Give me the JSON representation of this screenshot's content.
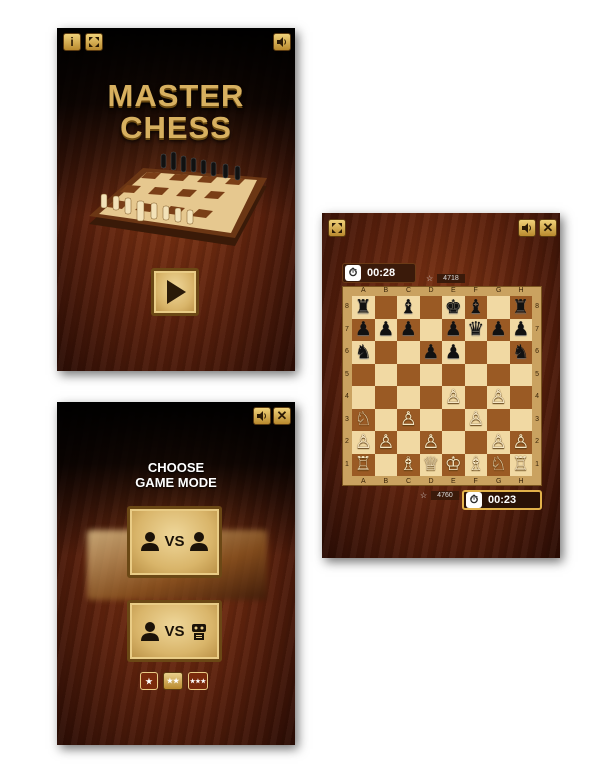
{
  "splash": {
    "title_line1": "MASTER",
    "title_line2": "CHESS",
    "info_label": "i",
    "play_icon": "play-icon"
  },
  "mode_select": {
    "title_line1": "CHOOSE",
    "title_line2": "GAME MODE",
    "pvp_label": "VS",
    "pvc_label": "VS",
    "difficulty": [
      "★",
      "★★",
      "★★★"
    ]
  },
  "game": {
    "opponent": {
      "time": "00:28",
      "score": "4718"
    },
    "player": {
      "time": "00:23",
      "score": "4760"
    },
    "files": [
      "A",
      "B",
      "C",
      "D",
      "E",
      "F",
      "G",
      "H"
    ],
    "ranks": [
      "8",
      "7",
      "6",
      "5",
      "4",
      "3",
      "2",
      "1"
    ],
    "pieces": [
      {
        "sq": "a8",
        "p": "♜"
      },
      {
        "sq": "c8",
        "p": "♝"
      },
      {
        "sq": "e8",
        "p": "♚"
      },
      {
        "sq": "f8",
        "p": "♝"
      },
      {
        "sq": "h8",
        "p": "♜"
      },
      {
        "sq": "a7",
        "p": "♟"
      },
      {
        "sq": "b7",
        "p": "♟"
      },
      {
        "sq": "c7",
        "p": "♟"
      },
      {
        "sq": "e7",
        "p": "♟"
      },
      {
        "sq": "f7",
        "p": "♛"
      },
      {
        "sq": "g7",
        "p": "♟"
      },
      {
        "sq": "h7",
        "p": "♟"
      },
      {
        "sq": "a6",
        "p": "♞"
      },
      {
        "sq": "d6",
        "p": "♟"
      },
      {
        "sq": "e6",
        "p": "♟"
      },
      {
        "sq": "h6",
        "p": "♞"
      },
      {
        "sq": "e4",
        "p": "♙"
      },
      {
        "sq": "g4",
        "p": "♙"
      },
      {
        "sq": "a3",
        "p": "♘"
      },
      {
        "sq": "c3",
        "p": "♙"
      },
      {
        "sq": "f3",
        "p": "♙"
      },
      {
        "sq": "a2",
        "p": "♙"
      },
      {
        "sq": "b2",
        "p": "♙"
      },
      {
        "sq": "d2",
        "p": "♙"
      },
      {
        "sq": "g2",
        "p": "♙"
      },
      {
        "sq": "h2",
        "p": "♙"
      },
      {
        "sq": "a1",
        "p": "♖"
      },
      {
        "sq": "c1",
        "p": "♗"
      },
      {
        "sq": "d1",
        "p": "♕"
      },
      {
        "sq": "e1",
        "p": "♔"
      },
      {
        "sq": "f1",
        "p": "♗"
      },
      {
        "sq": "g1",
        "p": "♘"
      },
      {
        "sq": "h1",
        "p": "♖"
      }
    ]
  },
  "icons": {
    "info": "info-icon",
    "fullscreen": "fullscreen-icon",
    "sound": "sound-icon",
    "close": "close-icon",
    "timer": "stopwatch-icon",
    "star": "star-icon",
    "user": "user-icon",
    "robot": "robot-icon"
  },
  "colors": {
    "gold": "#d7b060",
    "wood_dark": "#5a200c",
    "board_light": "#f1d9a3",
    "board_dark": "#9a5a24"
  }
}
